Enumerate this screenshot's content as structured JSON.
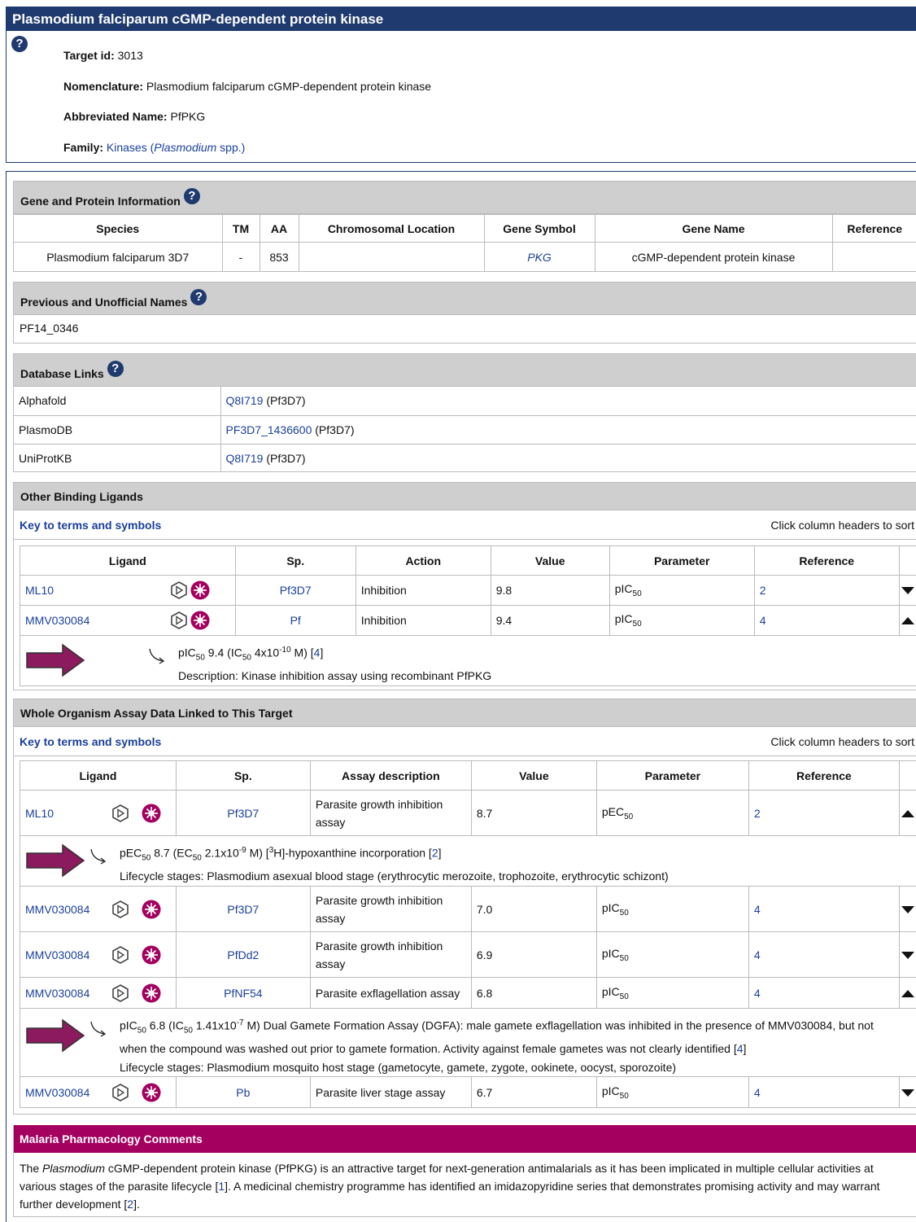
{
  "title": "Plasmodium falciparum cGMP-dependent protein kinase",
  "summary": {
    "target_id_label": "Target id:",
    "target_id": "3013",
    "nomenclature_label": "Nomenclature:",
    "nomenclature": "Plasmodium falciparum cGMP-dependent protein kinase",
    "abbrev_label": "Abbreviated Name:",
    "abbrev": "PfPKG",
    "family_label": "Family:",
    "family_link_text": "Kinases (",
    "family_link_italic": "Plasmodium",
    "family_link_tail": " spp.)"
  },
  "gene": {
    "heading": "Gene and Protein Information",
    "headers": [
      "Species",
      "TM",
      "AA",
      "Chromosomal Location",
      "Gene Symbol",
      "Gene Name",
      "Reference"
    ],
    "row": [
      "Plasmodium falciparum 3D7",
      "-",
      "853",
      "",
      "PKG",
      "cGMP-dependent protein kinase",
      ""
    ]
  },
  "previous": {
    "heading": "Previous and Unofficial Names",
    "value": "PF14_0346"
  },
  "db": {
    "heading": "Database Links",
    "rows": [
      {
        "name": "Alphafold",
        "link": "Q8I719",
        "suffix": " (Pf3D7)"
      },
      {
        "name": "PlasmoDB",
        "link": "PF3D7_1436600",
        "suffix": " (Pf3D7)"
      },
      {
        "name": "UniProtKB",
        "link": "Q8I719",
        "suffix": " (Pf3D7)"
      }
    ]
  },
  "binding": {
    "heading": "Other Binding Ligands",
    "key": "Key to terms and symbols",
    "sort_hint": "Click column headers to sort",
    "headers": [
      "Ligand",
      "Sp.",
      "Action",
      "Value",
      "Parameter",
      "Reference"
    ],
    "rows": [
      {
        "ligand": "ML10",
        "sp": "Pf3D7",
        "action": "Inhibition",
        "value": "9.8",
        "param": "pIC",
        "param_sub": "50",
        "ref": "2"
      },
      {
        "ligand": "MMV030084",
        "sp": "Pf",
        "action": "Inhibition",
        "value": "9.4",
        "param": "pIC",
        "param_sub": "50",
        "ref": "4"
      }
    ],
    "detail": {
      "line1_a": "pIC",
      "line1_sub1": "50",
      "line1_b": " 9.4 (IC",
      "line1_sub2": "50",
      "line1_c": " 4x10",
      "line1_sup": "-10",
      "line1_d": " M) [",
      "line1_ref": "4",
      "line1_e": "]",
      "line2": "Description: Kinase inhibition assay using recombinant PfPKG"
    }
  },
  "whole": {
    "heading": "Whole Organism Assay Data Linked to This Target",
    "key": "Key to terms and symbols",
    "sort_hint": "Click column headers to sort",
    "headers": [
      "Ligand",
      "Sp.",
      "Assay description",
      "Value",
      "Parameter",
      "Reference"
    ],
    "rows": [
      {
        "ligand": "ML10",
        "sp": "Pf3D7",
        "assay": "Parasite growth inhibition assay",
        "value": "8.7",
        "param": "pEC",
        "param_sub": "50",
        "ref": "2"
      },
      {
        "ligand": "MMV030084",
        "sp": "Pf3D7",
        "assay": "Parasite growth inhibition assay",
        "value": "7.0",
        "param": "pIC",
        "param_sub": "50",
        "ref": "4"
      },
      {
        "ligand": "MMV030084",
        "sp": "PfDd2",
        "assay": "Parasite growth inhibition assay",
        "value": "6.9",
        "param": "pIC",
        "param_sub": "50",
        "ref": "4"
      },
      {
        "ligand": "MMV030084",
        "sp": "PfNF54",
        "assay": "Parasite exflagellation assay",
        "value": "6.8",
        "param": "pIC",
        "param_sub": "50",
        "ref": "4"
      },
      {
        "ligand": "MMV030084",
        "sp": "Pb",
        "assay": "Parasite liver stage assay",
        "value": "6.7",
        "param": "pIC",
        "param_sub": "50",
        "ref": "4"
      }
    ],
    "detail1": {
      "a": "pEC",
      "sub1": "50",
      "b": " 8.7 (EC",
      "sub2": "50",
      "c": " 2.1x10",
      "sup1": "-9",
      "d": " M) [",
      "sup2": "3",
      "e": "H]-hypoxanthine incorporation [",
      "ref": "2",
      "f": "]",
      "line2": "Lifecycle stages: Plasmodium asexual blood stage (erythrocytic merozoite, trophozoite, erythrocytic schizont)"
    },
    "detail2": {
      "a": "pIC",
      "sub1": "50",
      "b": " 6.8 (IC",
      "sub2": "50",
      "c": " 1.41x10",
      "sup1": "-7",
      "d": " M) Dual Gamete Formation Assay (DGFA): male gamete exflagellation was inhibited in the presence of MMV030084, but not",
      "line2a": "when the compound was washed out prior to gamete formation. Activity against female gametes was not clearly identified [",
      "ref": "4",
      "line2b": "]",
      "line3": "Lifecycle stages: Plasmodium mosquito host stage (gametocyte, gamete, zygote, ookinete, oocyst, sporozoite)"
    }
  },
  "malaria": {
    "heading": "Malaria Pharmacology Comments",
    "p1": "The ",
    "p1_italic": "Plasmodium",
    "p2": " cGMP-dependent protein kinase (PfPKG) is an attractive target for next-generation antimalarials as it has been implicated in multiple cellular activities at",
    "p3": "various stages of the parasite lifecycle [",
    "ref1": "1",
    "p4": "]. A medicinal chemistry programme has identified an imidazopyridine series that demonstrates promising activity and may",
    "p5": "warrant further development [",
    "ref2": "2",
    "p6": "]."
  },
  "colors": {
    "title_bar": "#1f3a6e",
    "malaria_bar": "#a3005f",
    "arrow": "#8b1a5e",
    "link": "#1a3f9c"
  },
  "icons": [
    "help-icon",
    "hexagon-play-icon",
    "malaria-parasite-icon",
    "arrow-right-icon",
    "return-arrow-icon",
    "sort-down-icon",
    "sort-up-icon"
  ]
}
